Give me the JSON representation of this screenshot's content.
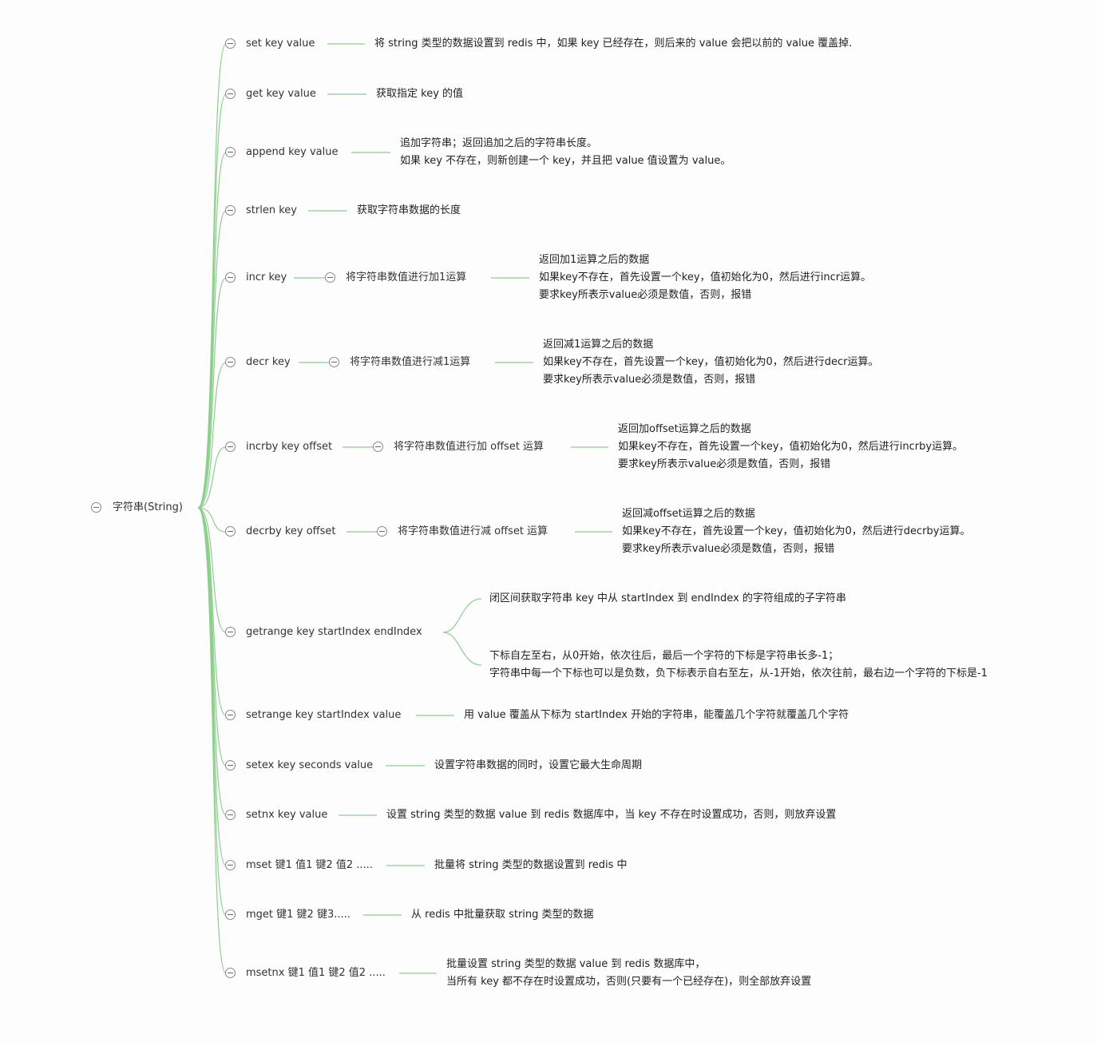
{
  "root": {
    "label": "字符串(String)"
  },
  "colors": {
    "branch_line": "#8ccf8c",
    "connector": "#90d090",
    "collapse_border": "#888888"
  },
  "commands": [
    {
      "label": "set key value",
      "description": [
        "将 string 类型的数据设置到 redis 中，如果 key 已经存在，则后来的 value 会把以前的 value 覆盖掉."
      ]
    },
    {
      "label": "get key value",
      "description": [
        "获取指定 key 的值"
      ]
    },
    {
      "label": "append key value",
      "description": [
        "追加字符串；返回追加之后的字符串长度。",
        "如果 key 不存在，则新创建一个 key，并且把 value 值设置为 value。"
      ]
    },
    {
      "label": "strlen key",
      "description": [
        "获取字符串数据的长度"
      ]
    },
    {
      "label": "incr key",
      "sub_label": "将字符串数值进行加1运算",
      "description": [
        "返回加1运算之后的数据",
        "如果key不存在，首先设置一个key，值初始化为0，然后进行incr运算。",
        "要求key所表示value必须是数值，否则，报错"
      ]
    },
    {
      "label": "decr key",
      "sub_label": "将字符串数值进行减1运算",
      "description": [
        "返回减1运算之后的数据",
        "如果key不存在，首先设置一个key，值初始化为0，然后进行decr运算。",
        "要求key所表示value必须是数值，否则，报错"
      ]
    },
    {
      "label": "incrby key offset",
      "sub_label": "将字符串数值进行加 offset 运算",
      "description": [
        "返回加offset运算之后的数据",
        "如果key不存在，首先设置一个key，值初始化为0，然后进行incrby运算。",
        "要求key所表示value必须是数值，否则，报错"
      ]
    },
    {
      "label": "decrby key offset",
      "sub_label": "将字符串数值进行减 offset 运算",
      "description": [
        "返回减offset运算之后的数据",
        "如果key不存在，首先设置一个key，值初始化为0，然后进行decrby运算。",
        "要求key所表示value必须是数值，否则，报错"
      ]
    },
    {
      "label": "getrange key startIndex endIndex",
      "branches": [
        [
          "闭区间获取字符串 key 中从 startIndex 到 endIndex 的字符组成的子字符串"
        ],
        [
          "下标自左至右，从0开始，依次往后，最后一个字符的下标是字符串长多-1；",
          "字符串中每一个下标也可以是负数，负下标表示自右至左，从-1开始，依次往前，最右边一个字符的下标是-1"
        ]
      ]
    },
    {
      "label": "setrange key startIndex value",
      "description": [
        "用 value 覆盖从下标为 startIndex 开始的字符串，能覆盖几个字符就覆盖几个字符"
      ]
    },
    {
      "label": "setex key seconds value",
      "description": [
        "设置字符串数据的同时，设置它最大生命周期"
      ]
    },
    {
      "label": "setnx key value",
      "description": [
        "设置 string 类型的数据 value 到 redis 数据库中，当 key 不存在时设置成功，否则，则放弃设置"
      ]
    },
    {
      "label": "mset 键1 值1 键2 值2 .....",
      "description": [
        "批量将 string 类型的数据设置到 redis 中"
      ]
    },
    {
      "label": "mget 键1 键2 键3.....",
      "description": [
        "从 redis 中批量获取 string 类型的数据"
      ]
    },
    {
      "label": "msetnx 键1 值1 键2 值2 .....",
      "description": [
        "批量设置 string 类型的数据 value 到 redis 数据库中，",
        "当所有 key 都不存在时设置成功，否则(只要有一个已经存在)，则全部放弃设置"
      ]
    }
  ]
}
